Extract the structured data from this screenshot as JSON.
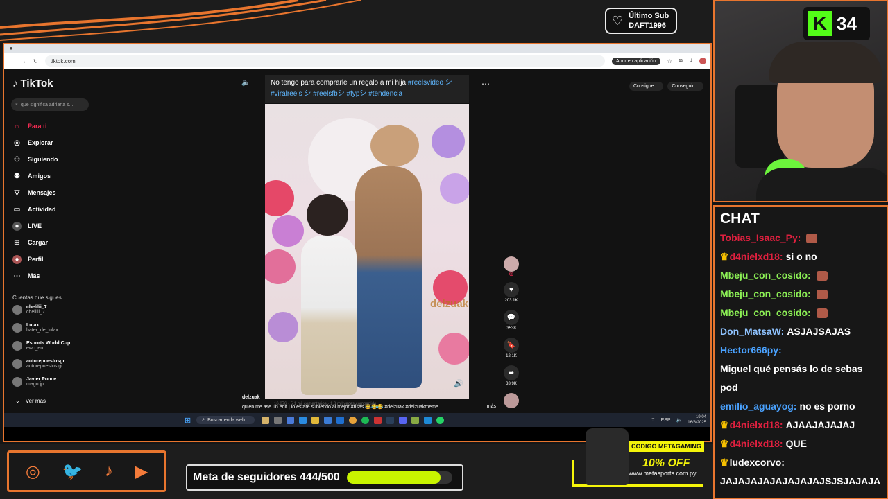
{
  "overlay": {
    "last_sub_label": "Último Sub",
    "last_sub_name": "DAFT1996",
    "kick_count": "34",
    "chat_title": "CHAT",
    "goal_label": "Meta de seguidores 444/500",
    "goal_progress": 0.888,
    "promo_code": "CODIGO METAGAMING",
    "promo_pct": "10% OFF",
    "promo_web": "www.metasports.com.py",
    "accent": "#e8752e"
  },
  "browser": {
    "url": "tiktok.com",
    "open_app": "Abrir en aplicación"
  },
  "tiktok": {
    "logo": "TikTok",
    "search_placeholder": "que significa adriana s...",
    "nav": [
      {
        "label": "Para ti",
        "icon": "home-icon"
      },
      {
        "label": "Explorar",
        "icon": "compass-icon"
      },
      {
        "label": "Siguiendo",
        "icon": "following-icon"
      },
      {
        "label": "Amigos",
        "icon": "friends-icon"
      },
      {
        "label": "Mensajes",
        "icon": "message-icon"
      },
      {
        "label": "Actividad",
        "icon": "activity-icon"
      },
      {
        "label": "LIVE",
        "icon": "live-icon"
      },
      {
        "label": "Cargar",
        "icon": "upload-icon"
      },
      {
        "label": "Perfil",
        "icon": "profile-icon"
      },
      {
        "label": "Más",
        "icon": "more-icon"
      }
    ],
    "following_header": "Cuentas que sigues",
    "accounts": [
      {
        "name": "chelilii_7",
        "handle": "chelilii_7"
      },
      {
        "name": "Lulax",
        "handle": "hater_de_lulax"
      },
      {
        "name": "Esports World Cup",
        "handle": "ewc_en"
      },
      {
        "name": "autorepuestosgr",
        "handle": "autorepuestos.gr"
      },
      {
        "name": "Javier Ponce",
        "handle": "mago.jp"
      }
    ],
    "see_more": "Ver más",
    "top_buttons": [
      "Consigue ...",
      "Conseguir ..."
    ],
    "caption_top": "No tengo para comprarle un regalo a mi hija",
    "caption_tags": "#reelsvideo シ #viralreels シ #reelsfbシ #fypシ #tendencia",
    "watermark": "delzuak",
    "likes": "203.1K",
    "comments": "3538",
    "saves": "12.1K",
    "shares": "33.9K",
    "user": "delzuak",
    "description": "quien me ase un edit | lo estaré subiendo al mejor #risas 😂😂😂 #delzuak #delzuakmeme ...",
    "more_link": "más",
    "meta_line": "16.876 · 5,1 mil comentarios · 1,8 mil veces compartido"
  },
  "taskbar": {
    "search": "Buscar en la web...",
    "lang": "ESP",
    "time": "19:04",
    "date": "16/8/2025"
  },
  "chat": [
    {
      "user": "Tobias_Isaac_Py:",
      "color": "#e0203f",
      "text": "",
      "emote": true,
      "crown": false
    },
    {
      "user": "d4nielxd18:",
      "color": "#e0203f",
      "text": "si o no",
      "emote": false,
      "crown": true
    },
    {
      "user": "Mbeju_con_cosido:",
      "color": "#8cf055",
      "text": "",
      "emote": true,
      "crown": false
    },
    {
      "user": "Mbeju_con_cosido:",
      "color": "#8cf055",
      "text": "",
      "emote": true,
      "crown": false
    },
    {
      "user": "Mbeju_con_cosido:",
      "color": "#8cf055",
      "text": "",
      "emote": true,
      "crown": false
    },
    {
      "user": "Don_MatsaW:",
      "color": "#8fc3ff",
      "text": "ASJAJSAJAS",
      "emote": false,
      "crown": false
    },
    {
      "user": "Hector666py:",
      "color": "#4aa2ff",
      "text": "Miguel qué pensás lo de sebas pod",
      "emote": false,
      "crown": false
    },
    {
      "user": "emilio_aguayog:",
      "color": "#4aa2ff",
      "text": "no es porno",
      "emote": false,
      "crown": false
    },
    {
      "user": "d4nielxd18:",
      "color": "#e0203f",
      "text": "AJAAJAJAJAJ",
      "emote": false,
      "crown": true
    },
    {
      "user": "d4nielxd18:",
      "color": "#e0203f",
      "text": "QUE",
      "emote": false,
      "crown": true
    },
    {
      "user": "ludexcorvo:",
      "color": "#ffffff",
      "text": "JAJAJAJAJAJAJAJAJSJSJAJAJA",
      "emote": false,
      "crown": true
    }
  ]
}
